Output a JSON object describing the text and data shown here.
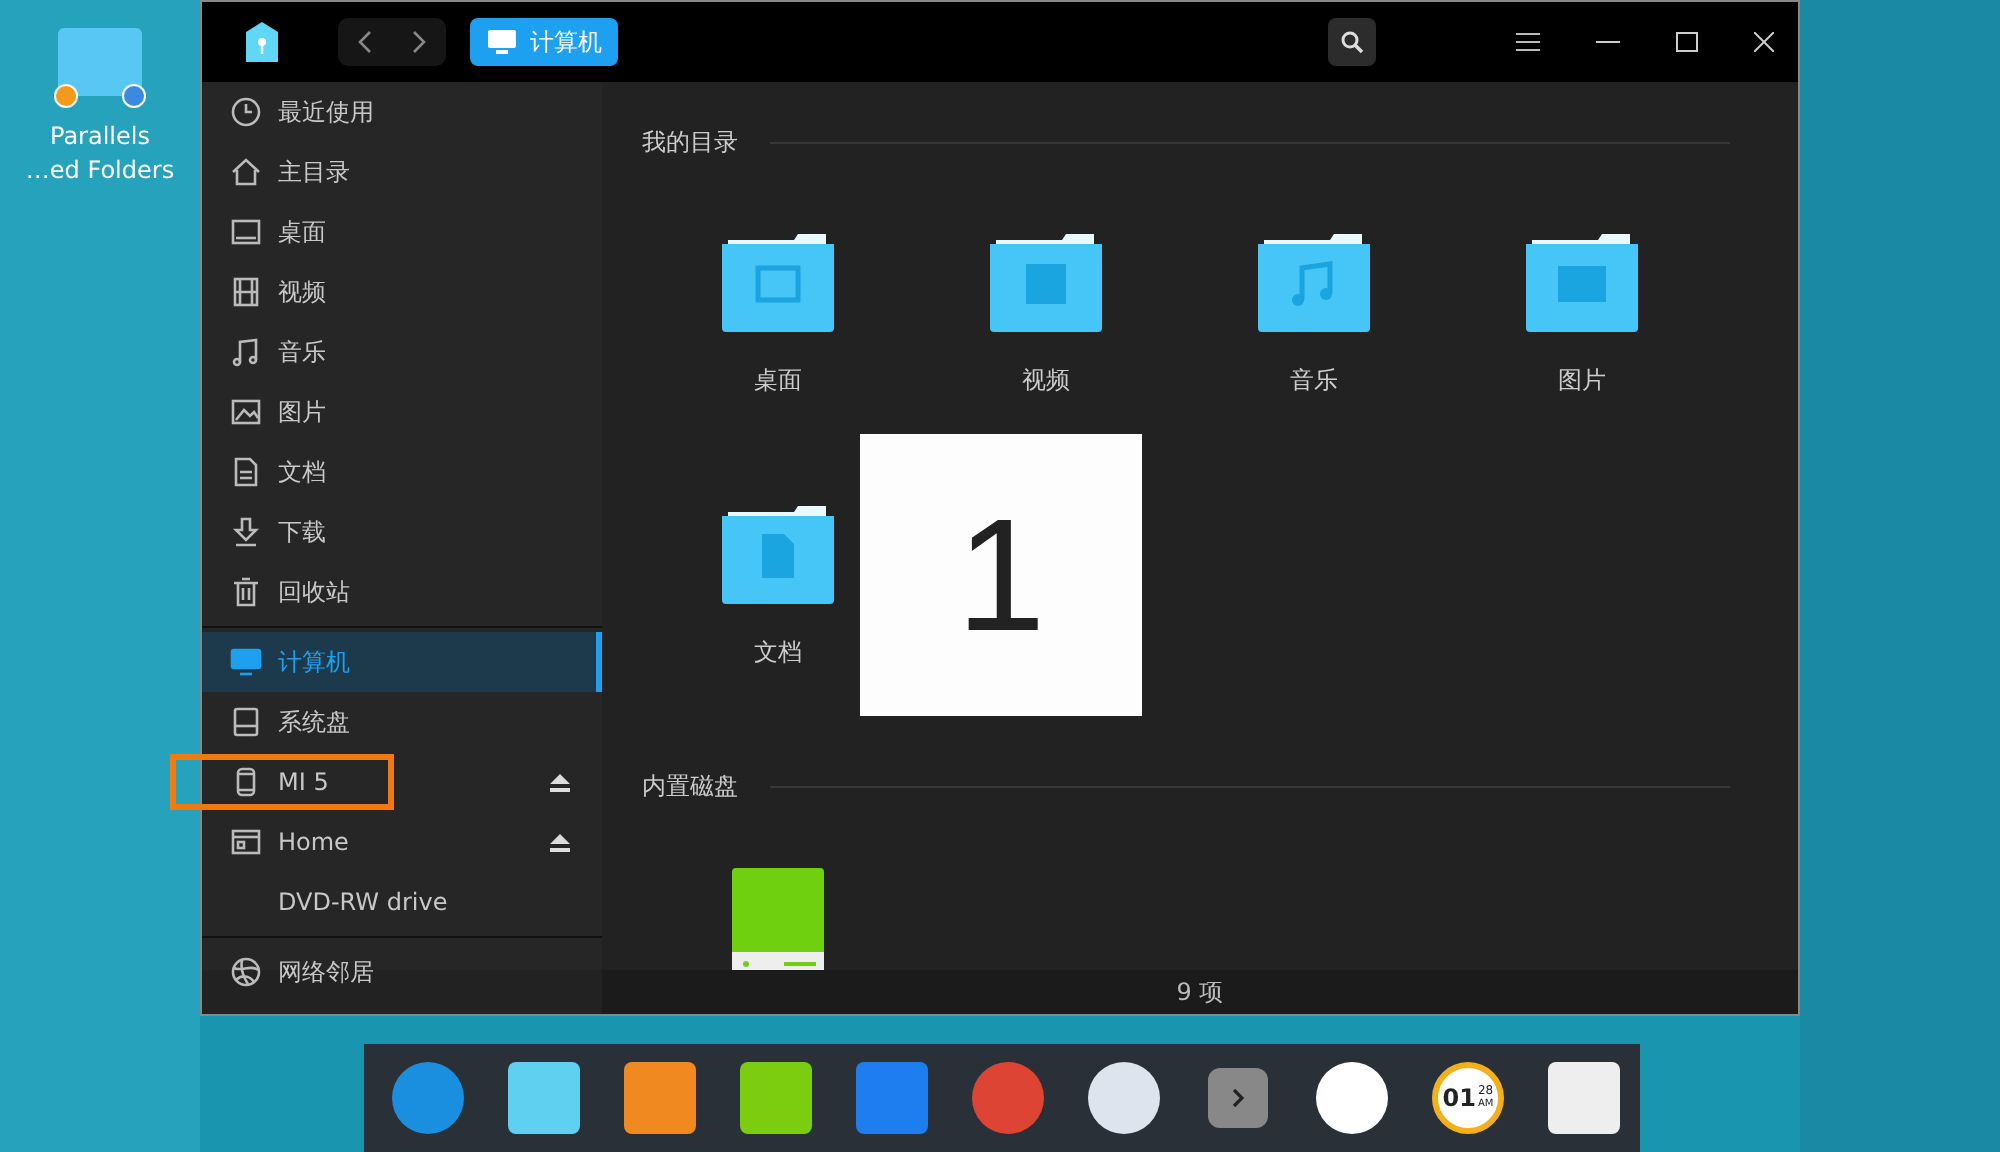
{
  "desktop_icon": {
    "label_lines": [
      "Parallels",
      "…ed Folders"
    ]
  },
  "window": {
    "breadcrumb": "计算机"
  },
  "sidebar": {
    "groups": [
      [
        {
          "label": "最近使用",
          "selected": false,
          "eject": false,
          "highlighted": false
        },
        {
          "label": "主目录",
          "selected": false,
          "eject": false,
          "highlighted": false
        },
        {
          "label": "桌面",
          "selected": false,
          "eject": false,
          "highlighted": false
        },
        {
          "label": "视频",
          "selected": false,
          "eject": false,
          "highlighted": false
        },
        {
          "label": "音乐",
          "selected": false,
          "eject": false,
          "highlighted": false
        },
        {
          "label": "图片",
          "selected": false,
          "eject": false,
          "highlighted": false
        },
        {
          "label": "文档",
          "selected": false,
          "eject": false,
          "highlighted": false
        },
        {
          "label": "下载",
          "selected": false,
          "eject": false,
          "highlighted": false
        },
        {
          "label": "回收站",
          "selected": false,
          "eject": false,
          "highlighted": false
        }
      ],
      [
        {
          "label": "计算机",
          "selected": true,
          "eject": false,
          "highlighted": false
        },
        {
          "label": "系统盘",
          "selected": false,
          "eject": false,
          "highlighted": false
        },
        {
          "label": "MI 5",
          "selected": false,
          "eject": true,
          "highlighted": true
        },
        {
          "label": "Home",
          "selected": false,
          "eject": true,
          "highlighted": false
        },
        {
          "label": "DVD-RW drive",
          "selected": false,
          "eject": false,
          "highlighted": false
        }
      ],
      [
        {
          "label": "网络邻居",
          "selected": false,
          "eject": false,
          "highlighted": false
        }
      ]
    ]
  },
  "sections": [
    {
      "title": "我的目录",
      "items": [
        {
          "kind": "folder",
          "label": "桌面"
        },
        {
          "kind": "folder",
          "label": "视频"
        },
        {
          "kind": "folder",
          "label": "音乐"
        },
        {
          "kind": "folder",
          "label": "图片"
        },
        {
          "kind": "folder",
          "label": "文档"
        }
      ]
    },
    {
      "title": "内置磁盘",
      "items": [
        {
          "kind": "drive"
        }
      ]
    }
  ],
  "overlay": {
    "text": "1"
  },
  "status_bar": "9 项",
  "dock": {
    "clock": {
      "hour": "01",
      "minute": "28",
      "ampm": "AM"
    }
  }
}
